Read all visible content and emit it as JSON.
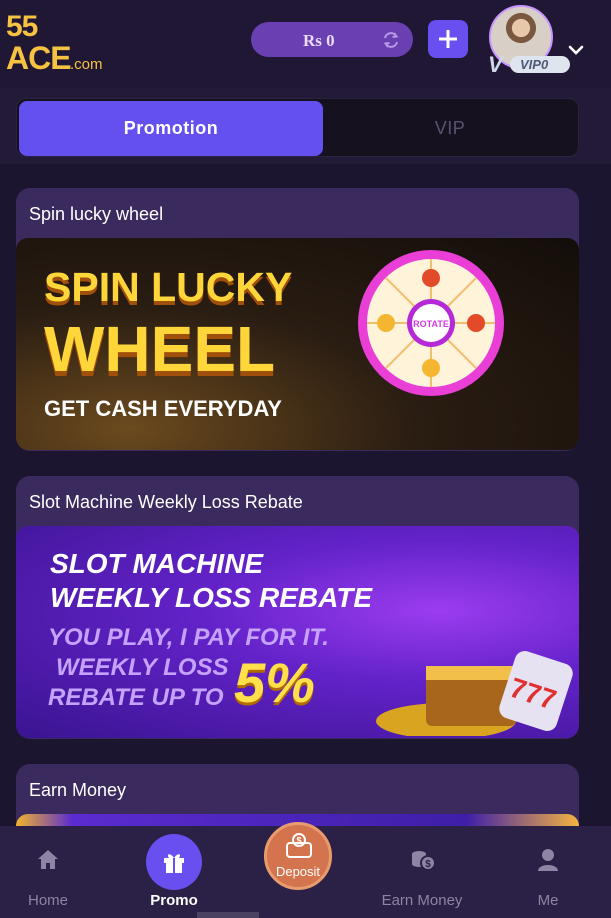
{
  "header": {
    "logo_number": "55",
    "logo_brand": "ACE",
    "logo_domain": ".com",
    "balance": "Rs 0",
    "vip_level": "VIP0"
  },
  "tabs": [
    {
      "label": "Promotion",
      "active": true
    },
    {
      "label": "VIP",
      "active": false
    }
  ],
  "cards": [
    {
      "title": "Spin lucky wheel",
      "banner_lines": [
        "SPIN LUCKY",
        "WHEEL",
        "GET CASH EVERYDAY"
      ],
      "wheel_center": "ROTATE"
    },
    {
      "title": "Slot Machine Weekly Loss Rebate",
      "banner_lines": [
        "SLOT MACHINE",
        "WEEKLY LOSS REBATE",
        "YOU PLAY, I PAY FOR IT.",
        "WEEKLY LOSS",
        "REBATE UP TO",
        "5%"
      ]
    },
    {
      "title": "Earn Money"
    }
  ],
  "bottom_nav": [
    {
      "label": "Home",
      "icon": "home-icon",
      "active": false
    },
    {
      "label": "Promo",
      "icon": "gift-icon",
      "active": true
    },
    {
      "label": "Deposit",
      "icon": "wallet-icon",
      "active": false
    },
    {
      "label": "Earn Money",
      "icon": "coins-icon",
      "active": false
    },
    {
      "label": "Me",
      "icon": "user-icon",
      "active": false
    }
  ],
  "colors": {
    "accent": "#6450ee",
    "background": "#1c1530",
    "card": "#3b2a5e",
    "gold": "#ffd63a",
    "deposit": "#d4744e"
  }
}
